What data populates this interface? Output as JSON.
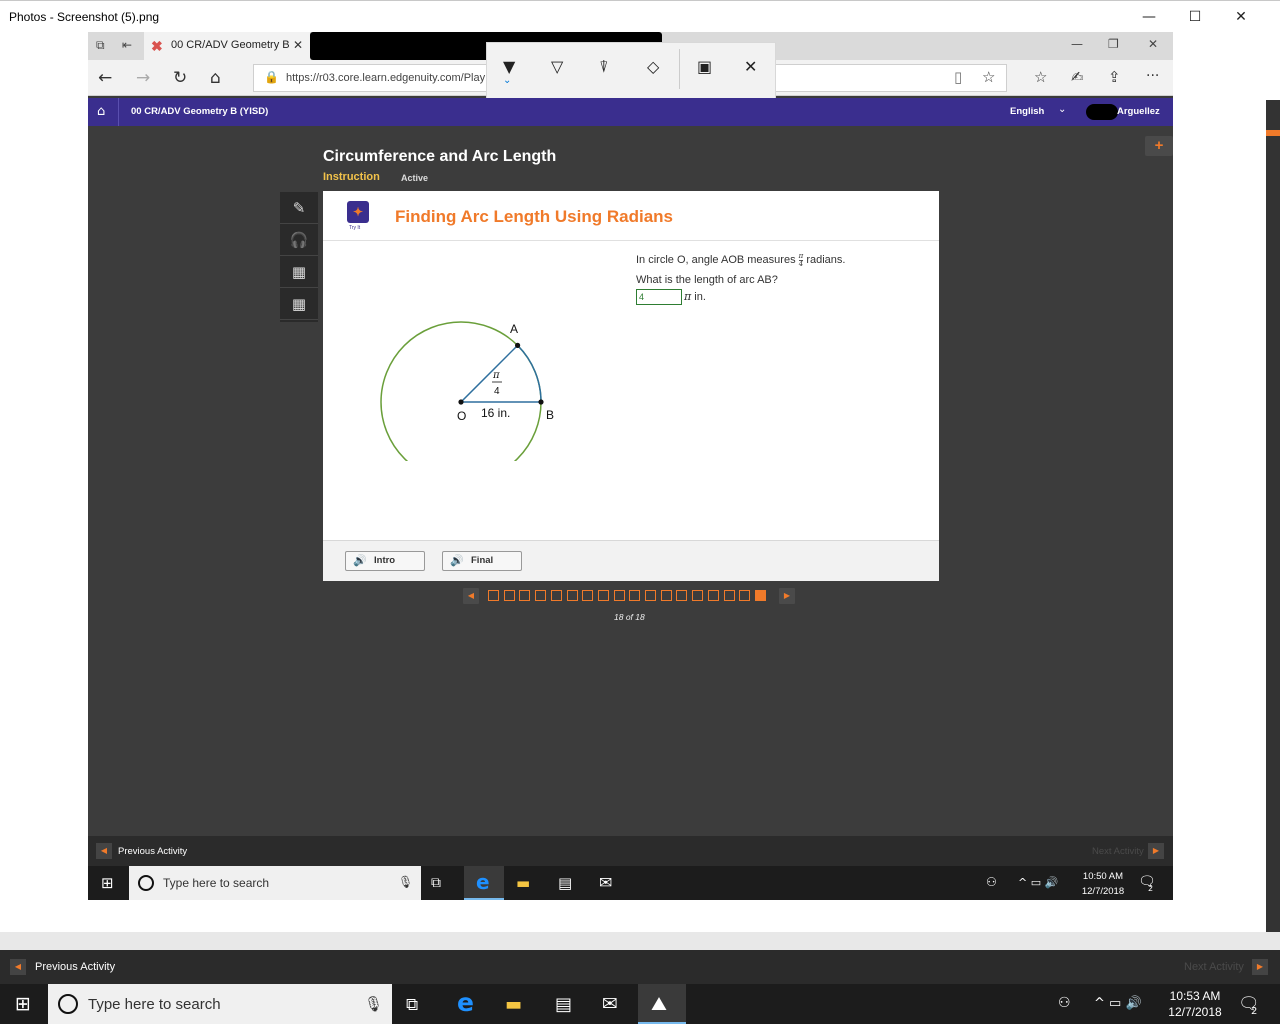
{
  "photos_window": {
    "title": "Photos - Screenshot (5).png",
    "minimize_glyph": "—",
    "maximize_glyph": "☐",
    "close_glyph": "✕"
  },
  "browser": {
    "tab_title": "00 CR/ADV Geometry B",
    "tab_close_glyph": "✕",
    "tab_icon_glyph": "✖",
    "address": "https://r03.core.learn.edgenuity.com/Play",
    "lock_glyph": "🔒",
    "back_glyph": "←",
    "forward_glyph": "→",
    "refresh_glyph": "↻",
    "home_glyph": "⌂",
    "reading_glyph": "▯",
    "favorite_glyph": "☆",
    "favorites_list_glyph": "☆",
    "notes_glyph": "✍",
    "share_glyph": "⇪",
    "more_glyph": "···",
    "min_glyph": "—",
    "restore_glyph": "❐",
    "close_glyph": "✕",
    "ink_tools": {
      "ballpoint_glyph": "▼",
      "pencil_glyph": "▽",
      "highlighter_glyph": "⍒",
      "eraser_glyph": "◇",
      "touch_glyph": "▣",
      "close_glyph": "✕"
    }
  },
  "site": {
    "course": "00 CR/ADV Geometry B (YISD)",
    "language": "English",
    "user": "Arguellez",
    "home_glyph": "⌂",
    "caret_glyph": "⌄",
    "plus_glyph": "+"
  },
  "lesson": {
    "title": "Circumference and Arc Length",
    "instruction_label": "Instruction",
    "status": "Active"
  },
  "tools": {
    "pencil_glyph": "✎",
    "audio_glyph": "🎧",
    "calc1_glyph": "▦",
    "calc2_glyph": "▦"
  },
  "card": {
    "heading": "Finding Arc Length Using Radians",
    "tryit_label": "Try It",
    "tryit_glyph": "✦",
    "question_line1_before": "In circle O, angle AOB measures",
    "question_line1_after": "radians.",
    "frac_num": "π",
    "frac_den": "4",
    "question_line2": "What is the length of arc AB?",
    "answer_value": "4",
    "answer_unit_symbol": "π",
    "answer_unit_text": " in.",
    "diagram": {
      "point_a": "A",
      "point_b": "B",
      "point_o": "O",
      "radius_label": "16 in.",
      "angle_num": "π",
      "angle_den": "4",
      "circle_color": "#6a9f3a",
      "sector_color": "#2e6f9e"
    },
    "intro_label": "Intro",
    "final_label": "Final",
    "speaker_glyph": "🔊"
  },
  "pager": {
    "total": 18,
    "current": 18,
    "label": "18 of 18",
    "prev_glyph": "◀",
    "next_glyph": "▶",
    "accent": "#f07a2a"
  },
  "inner_activity": {
    "previous": "Previous Activity",
    "next": "Next Activity",
    "prev_glyph": "◀",
    "next_glyph": "▶"
  },
  "inner_taskbar": {
    "search_placeholder": "Type here to search",
    "time": "10:50 AM",
    "date": "12/7/2018",
    "notif_count": "2",
    "start_glyph": "⊞",
    "mic_glyph": "🎙",
    "taskview_glyph": "⧉",
    "edge_glyph": "e",
    "explorer_glyph": "▬",
    "store_glyph": "▤",
    "mail_glyph": "✉",
    "people_glyph": "⚇",
    "tray_glyph": "^ ▭ 🔊",
    "notif_glyph": "🗨"
  },
  "outer_activity": {
    "previous": "Previous Activity",
    "next": "Next Activity",
    "prev_glyph": "◀",
    "next_glyph": "▶"
  },
  "outer_taskbar": {
    "search_placeholder": "Type here to search",
    "time": "10:53 AM",
    "date": "12/7/2018",
    "notif_count": "2",
    "start_glyph": "⊞",
    "mic_glyph": "🎙",
    "taskview_glyph": "⧉",
    "edge_glyph": "e",
    "explorer_glyph": "▬",
    "store_glyph": "▤",
    "mail_glyph": "✉",
    "photos_glyph": "⛰",
    "people_glyph": "⚇",
    "tray_glyph": "^ ▭ 🔊",
    "notif_glyph": "🗨"
  }
}
